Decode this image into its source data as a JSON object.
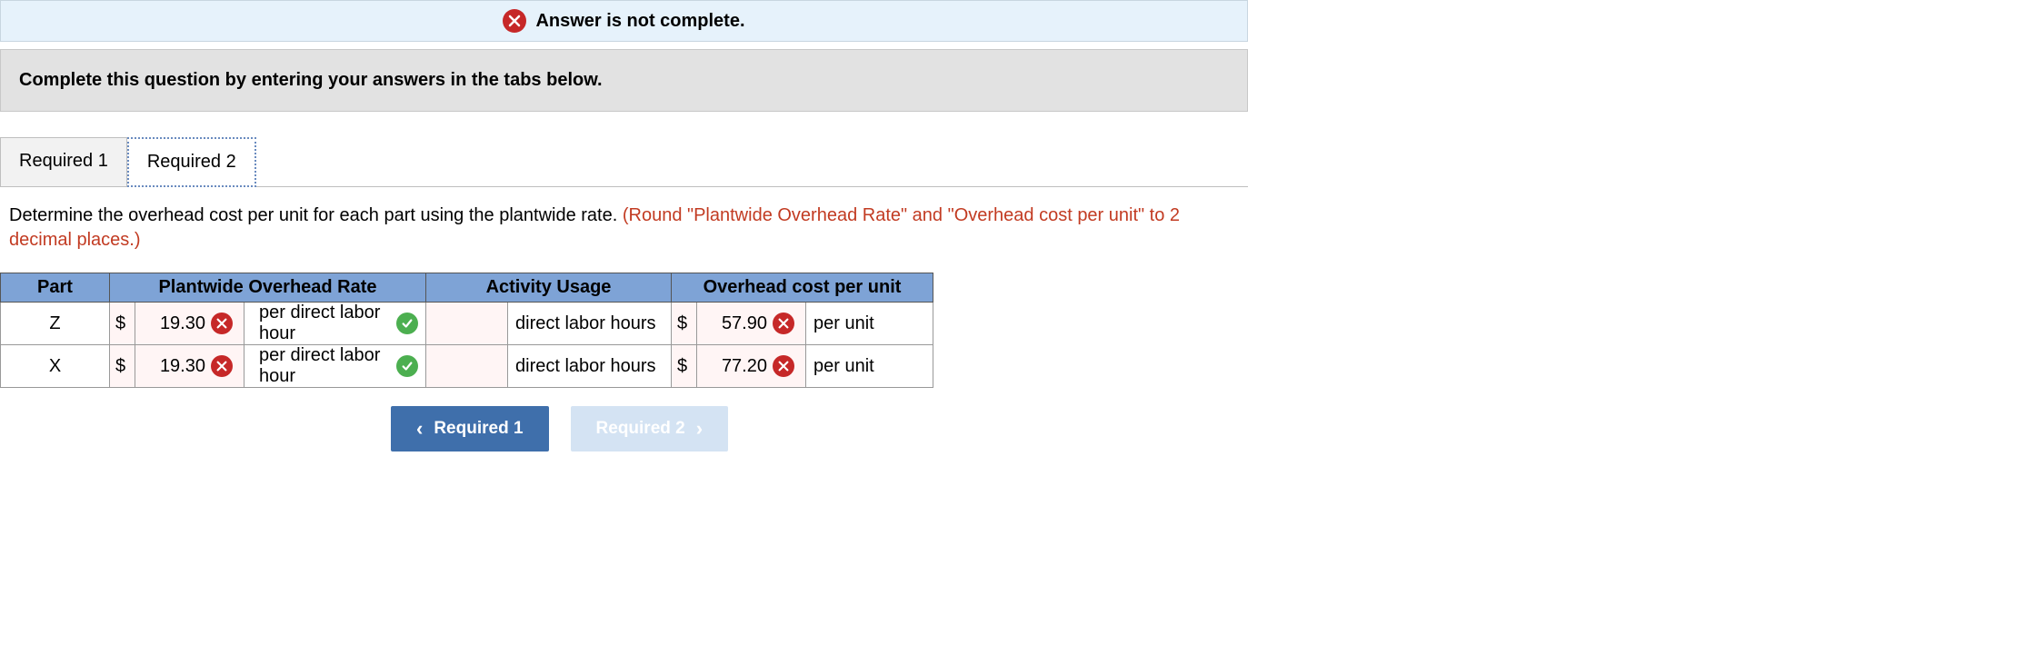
{
  "status": {
    "message": "Answer is not complete."
  },
  "instruction": "Complete this question by entering your answers in the tabs below.",
  "tabs": [
    {
      "label": "Required 1"
    },
    {
      "label": "Required 2"
    }
  ],
  "question": {
    "main": "Determine the overhead cost per unit for each part using the plantwide rate. ",
    "rounding": "(Round \"Plantwide Overhead Rate\" and \"Overhead cost per unit\" to 2 decimal places.)"
  },
  "headers": {
    "part": "Part",
    "rate": "Plantwide Overhead Rate",
    "activity": "Activity Usage",
    "cost": "Overhead cost per unit"
  },
  "rows": [
    {
      "part": "Z",
      "rate_value": "19.30",
      "rate_status": "wrong",
      "rate_unit": "per direct labor hour",
      "rate_unit_status": "correct",
      "activity": "direct labor hours",
      "cost_value": "57.90",
      "cost_status": "wrong",
      "cost_unit": "per unit"
    },
    {
      "part": "X",
      "rate_value": "19.30",
      "rate_status": "wrong",
      "rate_unit": "per direct labor hour",
      "rate_unit_status": "correct",
      "activity": "direct labor hours",
      "cost_value": "77.20",
      "cost_status": "wrong",
      "cost_unit": "per unit"
    }
  ],
  "symbols": {
    "currency": "$"
  },
  "nav": {
    "prev": "Required 1",
    "next": "Required 2"
  }
}
